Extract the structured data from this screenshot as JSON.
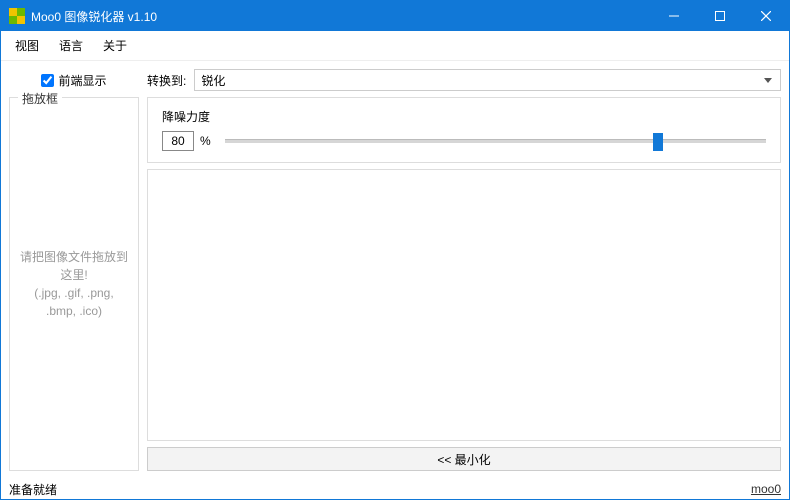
{
  "window": {
    "title": "Moo0 图像锐化器 v1.10"
  },
  "menu": {
    "view": "视图",
    "language": "语言",
    "about": "关于"
  },
  "top": {
    "front_show": "前端显示",
    "convert_to_label": "转换到:",
    "convert_selected": "锐化"
  },
  "dropzone": {
    "legend": "拖放框",
    "hint_line1": "请把图像文件拖放到这里!",
    "hint_line2": "(.jpg, .gif, .png, .bmp, .ico)"
  },
  "slider": {
    "title": "降噪力度",
    "value": "80",
    "percent": "%",
    "position_pct": 80
  },
  "minimize": {
    "label": "<< 最小化"
  },
  "status": {
    "ready": "准备就绪",
    "link": "moo0"
  }
}
